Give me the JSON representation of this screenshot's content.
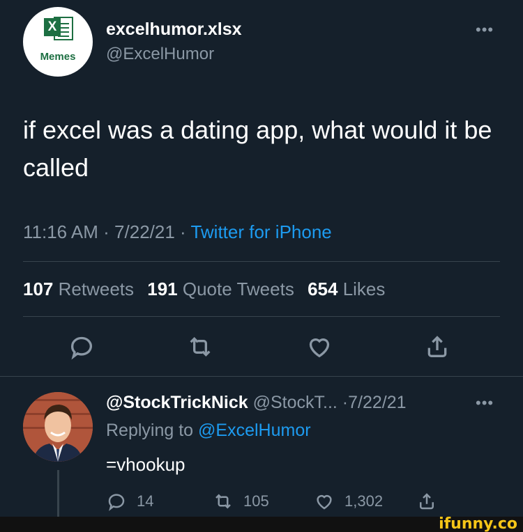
{
  "tweet": {
    "avatar_label": "Memes",
    "avatar_logo_letter": "X",
    "display_name": "excelhumor.xlsx",
    "handle": "@ExcelHumor",
    "more": "•••",
    "text": "if excel was a dating app, what would it be called",
    "time": "11:16 AM",
    "date": "7/22/21",
    "source": "Twitter for iPhone",
    "sep": " · ",
    "stats": {
      "retweets_count": "107",
      "retweets_label": "Retweets",
      "quotes_count": "191",
      "quotes_label": "Quote Tweets",
      "likes_count": "654",
      "likes_label": "Likes"
    },
    "icons": [
      "reply-icon",
      "retweet-icon",
      "like-icon",
      "share-icon"
    ]
  },
  "reply": {
    "name": "@StockTrickNick",
    "handle": "@StockT...",
    "date": "7/22/21",
    "sep": " ·",
    "more": "•••",
    "replying_to_label": "Replying to",
    "replying_to_handle": "@ExcelHumor",
    "text": "=vhookup",
    "replies": "14",
    "retweets": "105",
    "likes": "1,302"
  },
  "watermark": "ifunny.co",
  "colors": {
    "background": "#15202b",
    "muted": "#8b98a5",
    "link": "#1d9bf0",
    "excel_green": "#1d6f42",
    "watermark": "#f5c518"
  }
}
